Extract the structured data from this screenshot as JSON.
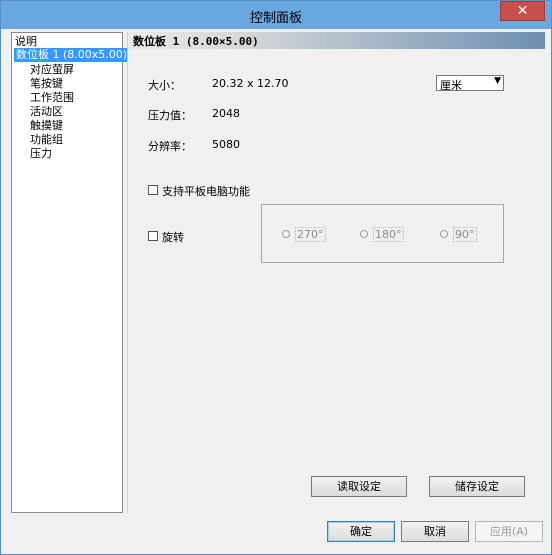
{
  "window": {
    "title": "控制面板",
    "close_label": "✕"
  },
  "tree": {
    "items": [
      {
        "label": "说明",
        "selected": false,
        "level": 0
      },
      {
        "label": "数位板  1 (8.00x5.00)",
        "selected": true,
        "level": 0
      },
      {
        "label": "对应萤屏",
        "selected": false,
        "level": 1
      },
      {
        "label": "笔按键",
        "selected": false,
        "level": 1
      },
      {
        "label": "工作范围",
        "selected": false,
        "level": 1
      },
      {
        "label": "活动区",
        "selected": false,
        "level": 1
      },
      {
        "label": "触摸键",
        "selected": false,
        "level": 1
      },
      {
        "label": "功能组",
        "selected": false,
        "level": 1
      },
      {
        "label": "压力",
        "selected": false,
        "level": 1
      }
    ]
  },
  "panel": {
    "header": "数位板  1 (8.00×5.00)",
    "size_label": "大小：",
    "size_value": "20.32 x 12.70",
    "unit_select": "厘米",
    "pressure_label": "压力值：",
    "pressure_value": "2048",
    "resolution_label": "分辨率：",
    "resolution_value": "5080",
    "tablet_pc_label": "支持平板电脑功能",
    "rotate_label": "旋转",
    "rotations": [
      "270°",
      "180°",
      "90°"
    ],
    "read_button": "读取设定",
    "save_button": "储存设定"
  },
  "footer": {
    "ok": "确定",
    "cancel": "取消",
    "apply": "应用(A)"
  }
}
